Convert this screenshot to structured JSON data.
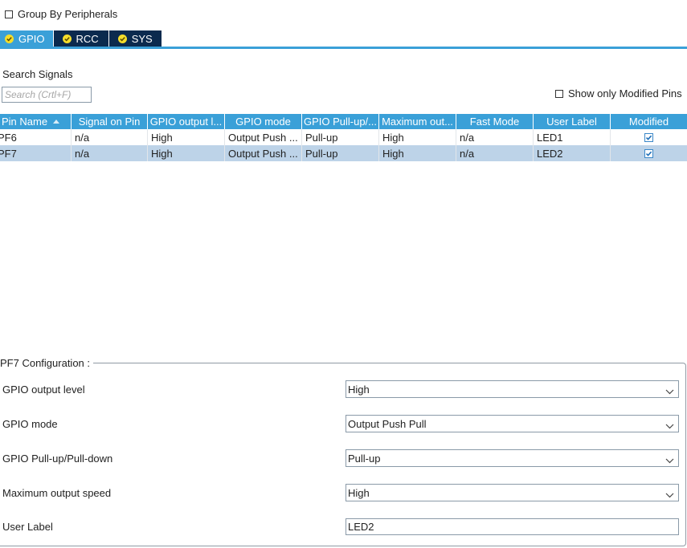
{
  "group_by_peripherals": {
    "label": "Group By Peripherals",
    "checked": false
  },
  "tabs": [
    {
      "label": "GPIO",
      "active": true,
      "icon": "check-circle-icon"
    },
    {
      "label": "RCC",
      "active": false,
      "icon": "check-circle-icon"
    },
    {
      "label": "SYS",
      "active": false,
      "icon": "check-circle-icon"
    }
  ],
  "search": {
    "heading": "Search Signals",
    "placeholder": "Search (Crtl+F)",
    "value": ""
  },
  "show_modified": {
    "label": "Show only Modified Pins",
    "checked": false
  },
  "table": {
    "columns": [
      "Pin Name",
      "Signal on Pin",
      "GPIO output l...",
      "GPIO mode",
      "GPIO Pull-up/...",
      "Maximum out...",
      "Fast Mode",
      "User Label",
      "Modified"
    ],
    "sort_column": "Pin Name",
    "rows": [
      {
        "pin": "PF6",
        "signal": "n/a",
        "output_level": "High",
        "mode": "Output Push ...",
        "pull": "Pull-up",
        "speed": "High",
        "fast": "n/a",
        "label": "LED1",
        "modified": true,
        "selected": false
      },
      {
        "pin": "PF7",
        "signal": "n/a",
        "output_level": "High",
        "mode": "Output Push ...",
        "pull": "Pull-up",
        "speed": "High",
        "fast": "n/a",
        "label": "LED2",
        "modified": true,
        "selected": true
      }
    ]
  },
  "config": {
    "title": "PF7 Configuration :",
    "fields": [
      {
        "label": "GPIO output level",
        "value": "High"
      },
      {
        "label": "GPIO mode",
        "value": "Output Push Pull"
      },
      {
        "label": "GPIO Pull-up/Pull-down",
        "value": "Pull-up"
      },
      {
        "label": "Maximum output speed",
        "value": "High"
      }
    ],
    "user_label": {
      "label": "User Label",
      "value": "LED2"
    }
  },
  "colors": {
    "accent": "#3aa0d8",
    "tab_inactive": "#0b2a4e",
    "selected_row": "#bdd3e8",
    "check_icon": "#f4dd2b"
  }
}
